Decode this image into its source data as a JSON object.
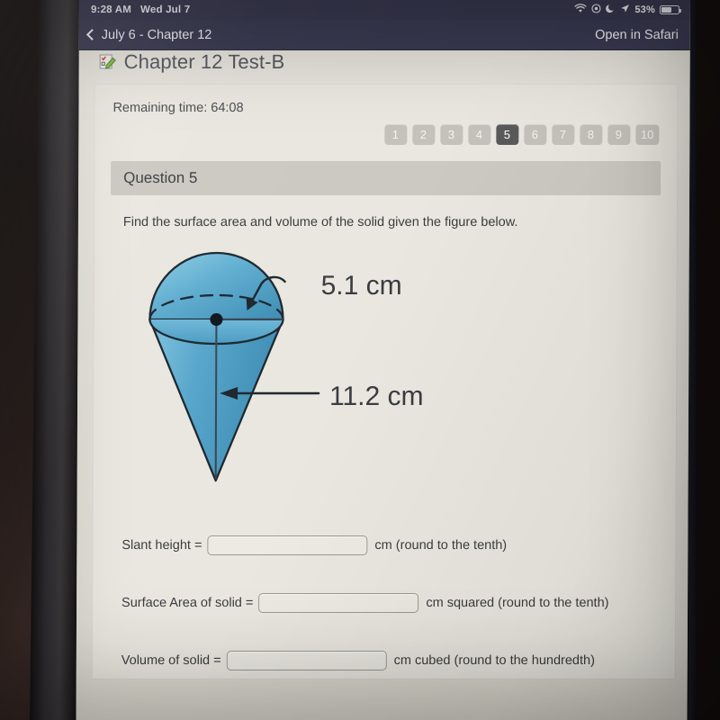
{
  "status_bar": {
    "time": "9:28 AM",
    "date": "Wed Jul 7",
    "battery_percent": "53%",
    "icons": [
      "wifi-icon",
      "screen-record-icon",
      "do-not-disturb-moon-icon",
      "location-arrow-icon",
      "battery-icon"
    ]
  },
  "nav_bar": {
    "back_label": "July 6 - Chapter 12",
    "right_action": "Open in Safari"
  },
  "quiz": {
    "title": "Chapter 12 Test-B",
    "remaining_time_label": "Remaining time: 64:08",
    "question_header": "Question 5",
    "prompt": "Find the surface area and volume of the solid given the figure below."
  },
  "question_nav": {
    "items": [
      "1",
      "2",
      "3",
      "4",
      "5",
      "6",
      "7",
      "8",
      "9",
      "10"
    ],
    "active": "5"
  },
  "figure": {
    "description": "cone-with-hemisphere-solid",
    "radius_label": "5.1 cm",
    "height_label": "11.2 cm",
    "fill_color": "#5aa6ca",
    "stroke_color": "#1e2830"
  },
  "answers": [
    {
      "label": "Slant height =",
      "value": "",
      "placeholder": "",
      "unit": "cm (round to the tenth)"
    },
    {
      "label": "Surface Area of solid =",
      "value": "",
      "placeholder": "",
      "unit": "cm squared (round to the tenth)"
    },
    {
      "label": "Volume of solid =",
      "value": "",
      "placeholder": "",
      "unit": "cm cubed (round to the hundredth)"
    }
  ]
}
